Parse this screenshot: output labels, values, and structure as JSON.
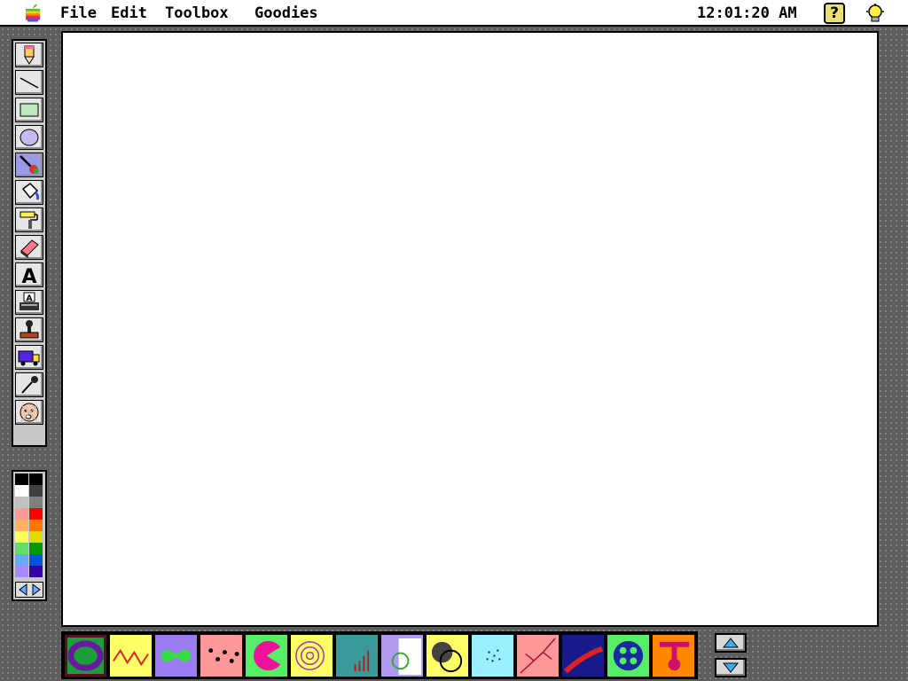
{
  "menubar": {
    "apple_icon": "apple-rainbow-icon",
    "items": [
      "File",
      "Edit",
      "Toolbox",
      "Goodies"
    ],
    "clock": "12:01:20 AM",
    "help_label": "?",
    "help_icon": "help-question-icon",
    "lightbulb_icon": "lightbulb-icon"
  },
  "tools": [
    {
      "name": "pencil-tool",
      "icon": "pencil-icon"
    },
    {
      "name": "line-tool",
      "icon": "line-icon"
    },
    {
      "name": "rectangle-tool",
      "icon": "rectangle-icon"
    },
    {
      "name": "oval-tool",
      "icon": "oval-icon"
    },
    {
      "name": "magic-brush-tool",
      "icon": "paintbrush-icon",
      "selected": true
    },
    {
      "name": "paint-bucket-tool",
      "icon": "paint-bucket-icon"
    },
    {
      "name": "roller-tool",
      "icon": "paint-roller-icon"
    },
    {
      "name": "eraser-tool",
      "icon": "eraser-icon"
    },
    {
      "name": "text-tool",
      "icon": "letter-a-icon",
      "label": "A"
    },
    {
      "name": "typewriter-tool",
      "icon": "typewriter-icon",
      "label": "A"
    },
    {
      "name": "rubber-stamp-tool",
      "icon": "stamp-icon"
    },
    {
      "name": "moving-van-tool",
      "icon": "truck-icon"
    },
    {
      "name": "eyedropper-tool",
      "icon": "eyedropper-icon"
    },
    {
      "name": "undo-guy-tool",
      "icon": "face-icon"
    }
  ],
  "palette": {
    "colors": [
      [
        "#000000",
        "#000000"
      ],
      [
        "#ffffff",
        "#404040"
      ],
      [
        "#c0c0c0",
        "#808080"
      ],
      [
        "#ff9999",
        "#ff0000"
      ],
      [
        "#ffb060",
        "#ff7700"
      ],
      [
        "#ffff55",
        "#dddd00"
      ],
      [
        "#66dd66",
        "#009900"
      ],
      [
        "#66aaff",
        "#0055dd"
      ],
      [
        "#aa88ff",
        "#3300aa"
      ]
    ],
    "left_arrow_icon": "arrow-left-icon",
    "right_arrow_icon": "arrow-right-icon"
  },
  "strip": {
    "items": [
      {
        "name": "brush-purple-swirl",
        "bg": "#1e9e3a",
        "selected": true
      },
      {
        "name": "brush-zigzag",
        "bg": "#ffff66"
      },
      {
        "name": "brush-green-blobs",
        "bg": "#9a7cf0"
      },
      {
        "name": "brush-dots",
        "bg": "#ff9999"
      },
      {
        "name": "brush-pacman",
        "bg": "#55ee66"
      },
      {
        "name": "brush-spiral",
        "bg": "#ffff66"
      },
      {
        "name": "brush-bars",
        "bg": "#3a9a9a"
      },
      {
        "name": "brush-bubble",
        "bg": "#b09af0"
      },
      {
        "name": "brush-checker-ball",
        "bg": "#ffff66"
      },
      {
        "name": "brush-spray",
        "bg": "#99eeff"
      },
      {
        "name": "brush-branches",
        "bg": "#ff9999"
      },
      {
        "name": "brush-red-stroke",
        "bg": "#1a1a8a"
      },
      {
        "name": "brush-button",
        "bg": "#55ee66"
      },
      {
        "name": "brush-drips",
        "bg": "#ff8800"
      }
    ],
    "up_icon": "scroll-up-icon",
    "down_icon": "scroll-down-icon"
  }
}
